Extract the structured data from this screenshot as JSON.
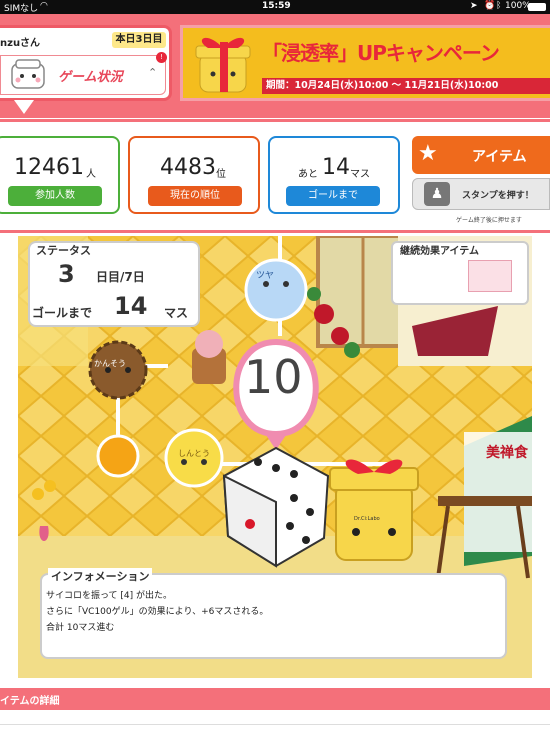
{
  "status_bar": {
    "carrier": "SIMなし",
    "time": "15:59",
    "battery": "100%"
  },
  "header": {
    "user_name": "nzuさん",
    "day_badge": "本日3日目",
    "game_status_label": "ゲーム状況",
    "notification_count": "!"
  },
  "banner": {
    "title": "「浸透率」UPキャンペーン",
    "period": "期間：10月24日(水)10:00 ～ 11月21日(水)10:00"
  },
  "stats": [
    {
      "value": "12461",
      "unit": "人",
      "button": "参加人数",
      "color": "#4caf3a"
    },
    {
      "value": "4483",
      "unit": "位",
      "button": "現在の順位",
      "color": "#e85a1c"
    },
    {
      "prefix": "あと",
      "value": "14",
      "unit": "マス",
      "button": "ゴールまで",
      "color": "#1e88d8"
    }
  ],
  "actions": {
    "item_label": "アイテム",
    "stamp_label": "スタンプを押す！",
    "stamp_note": "ゲーム終了後に押せます"
  },
  "game": {
    "status_title": "ステータス",
    "day_current": "3",
    "day_label": "日目/7日",
    "goal_label": "ゴールまで",
    "remaining": "14",
    "masu_label": "マス",
    "effect_title": "継続効果アイテム",
    "bubble_number": "10",
    "node_labels": [
      "ツヤ",
      "かんそう",
      "しんとう"
    ],
    "box_label": "美禅食",
    "jar_label": "Dr.Ci:Labo"
  },
  "info": {
    "title": "インフォメーション",
    "lines": [
      "サイコロを振って [4] が出た。",
      "さらに「VC100ゲル」の効果により、+6マスされる。",
      "合計 10マス進む"
    ]
  },
  "footer": {
    "detail_label": "イテムの詳細"
  }
}
